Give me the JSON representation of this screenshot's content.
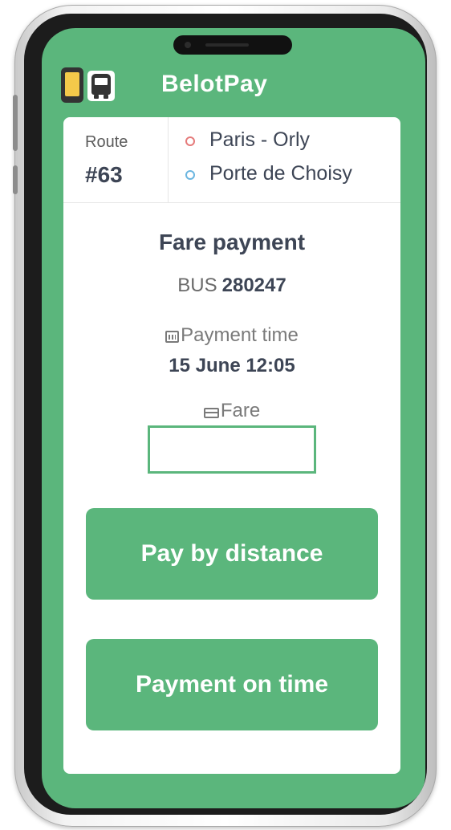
{
  "app": {
    "title": "BelotPay",
    "logo_icons": [
      "phone-icon",
      "bus-icon"
    ],
    "accent_color": "#5bb67c"
  },
  "route": {
    "label": "Route",
    "number": "#63",
    "origin": "Paris - Orly",
    "destination": "Porte de Choisy"
  },
  "payment": {
    "title": "Fare payment",
    "bus_label": "BUS",
    "bus_number": "280247",
    "time_label": "Payment time",
    "time_value": "15 June 12:05",
    "fare_label": "Fare",
    "fare_value": ""
  },
  "actions": {
    "pay_by_distance": "Pay by distance",
    "payment_on_time": "Payment on time"
  }
}
